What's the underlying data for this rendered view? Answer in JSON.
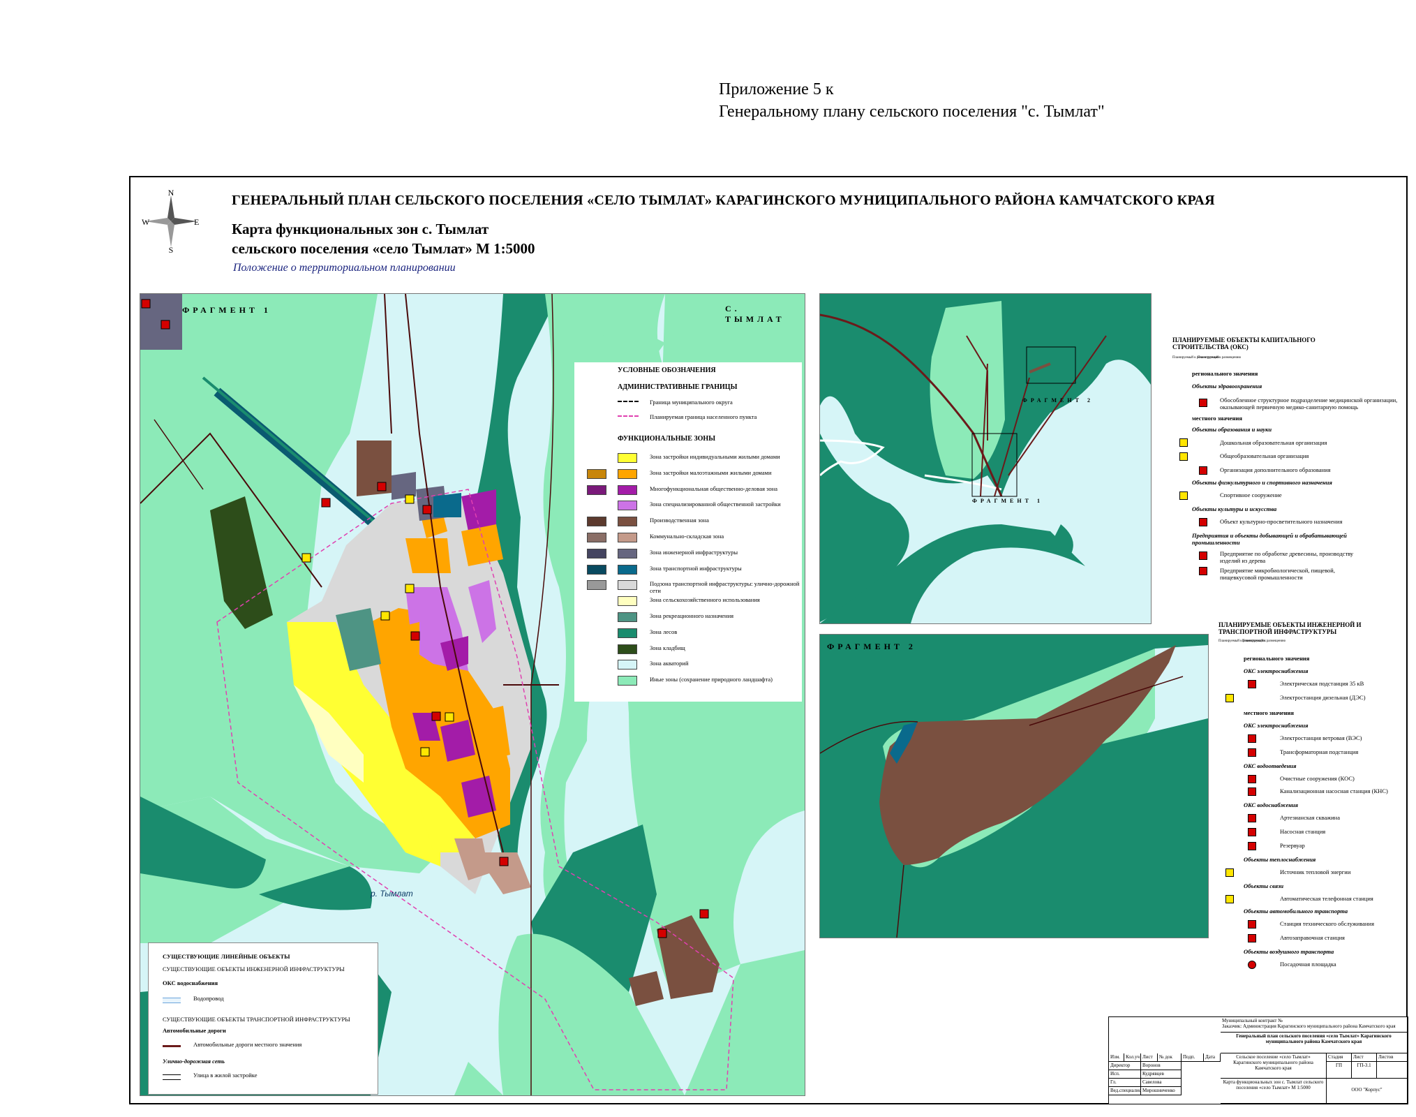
{
  "appendix": {
    "line1": "Приложение 5 к",
    "line2": "Генеральному плану сельского поселения \"с. Тымлат\""
  },
  "compass": {
    "n": "N",
    "s": "S",
    "w": "W",
    "e": "E"
  },
  "title": "ГЕНЕРАЛЬНЫЙ ПЛАН СЕЛЬСКОГО ПОСЕЛЕНИЯ «СЕЛО ТЫМЛАТ» КАРАГИНСКОГО МУНИЦИПАЛЬНОГО РАЙОНА КАМЧАТСКОГО КРАЯ",
  "subtitle": {
    "line1": "Карта функциональных зон с. Тымлат",
    "line2": "сельского поселения «село Тымлат»  М 1:5000"
  },
  "regulation": "Положение о территориальном планировании",
  "main_map": {
    "fragment_label": "ФРАГМЕНТ 1",
    "village_label": "С. ТЫМЛАТ",
    "river_label": "р. Тымлат"
  },
  "inset1": {
    "frag2_label": "ФРАГМЕНТ 2",
    "frag1_label": "ФРАГМЕНТ 1"
  },
  "inset2": {
    "label": "ФРАГМЕНТ 2"
  },
  "colors": {
    "water": "#d6f5f7",
    "natural": "#8ceab8",
    "forest": "#1a8c6e",
    "individual": "#ffff33",
    "lowrise": "#ffa500",
    "mixed": "#a31ca8",
    "special": "#cc73e6",
    "production": "#7a5040",
    "warehouse": "#c49a8a",
    "engineering": "#666680",
    "transport": "#0a6a8c",
    "street": "#d9d9d9",
    "agricultural": "#ffffc0",
    "recreation": "#4e9484",
    "cemetery": "#2d4d1a"
  },
  "legend": {
    "title": "УСЛОВНЫЕ ОБОЗНАЧЕНИЯ",
    "admin_header": "АДМИНИСТРАТИВНЫЕ ГРАНИЦЫ",
    "admin_items": [
      "Граница муниципального округа",
      "Планируемая граница населенного пункта"
    ],
    "zones_header": "ФУНКЦИОНАЛЬНЫЕ ЗОНЫ",
    "zones": [
      "Зона застройки индивидуальными жилыми домами",
      "Зона застройки малоэтажными жилыми домами",
      "Многофункциональная общественно-деловая зона",
      "Зона специализированной общественной застройки",
      "Производственная зона",
      "Коммунально-складская зона",
      "Зона инженерной инфраструктуры",
      "Зона транспортной инфраструктуры",
      "Подзона транспортной инфраструктуры: улично-дорожной сети",
      "Зона сельскохозяйственного использования",
      "Зона рекреационного назначения",
      "Зона лесов",
      "Зона кладбищ",
      "Зона акваторий",
      "Иные зоны (сохранение природного ландшафта)"
    ]
  },
  "linear_legend": {
    "title": "СУЩЕСТВУЮЩИЕ ЛИНЕЙНЫЕ ОБЪЕКТЫ",
    "eng_header": "СУЩЕСТВУЮЩИЕ ОБЪЕКТЫ ИНЖЕНЕРНОЙ ИНФРАСТРУКТУРЫ",
    "water_header": "ОКС водоснабжения",
    "water_item": "Водопровод",
    "transport_header": "СУЩЕСТВУЮЩИЕ ОБЪЕКТЫ ТРАНСПОРТНОЙ ИНФРАСТРУКТУРЫ",
    "roads_header": "Автомобильные дороги",
    "roads_item": "Автомобильные дороги местного значения",
    "street_header": "Улично-дорожная сеть",
    "street_item": "Улица в жилой застройке"
  },
  "planned_oks": {
    "title": "ПЛАНИРУЕМЫЕ ОБЪЕКТЫ КАПИТАЛЬНОГО СТРОИТЕЛЬСТВА (ОКС)",
    "col1": "Планируемый к реконструкции",
    "col2": "Планируемый к размещению",
    "regional": "регионального значения",
    "health": "Объекты здравоохранения",
    "health_item": "Обособленное структурное подразделение медицинской организации, оказывающей первичную медико-санитарную помощь",
    "local": "местного значения",
    "education": "Объекты образования и науки",
    "edu_items": [
      "Дошкольная образовательная организация",
      "Общеобразовательная организация",
      "Организация дополнительного образования"
    ],
    "sport": "Объекты физкультурного и спортивного назначения",
    "sport_item": "Спортивное сооружение",
    "culture": "Объекты культуры и искусства",
    "culture_item": "Объект культурно-просветительного назначения",
    "industry": "Предприятия и объекты добывающей и обрабатывающей промышленности",
    "industry_items": [
      "Предприятие по обработке древесины, производству изделий из дерева",
      "Предприятие микробиологической, пищевой, пищевкусовой промышленности"
    ]
  },
  "planned_eng": {
    "title": "ПЛАНИРУЕМЫЕ ОБЪЕКТЫ ИНЖЕНЕРНОЙ И ТРАНСПОРТНОЙ ИНФРАСТРУКТУРЫ",
    "col1": "Планируемый к реконструкции",
    "col2": "Планируемый к размещению",
    "regional": "регионального значения",
    "power_reg": "ОКС электроснабжения",
    "power_reg_items": [
      "Электрическая подстанция 35 кВ",
      "Электростанция дизельная (ДЭС)"
    ],
    "local": "местного значения",
    "power_loc": "ОКС электроснабжения",
    "power_loc_items": [
      "Электростанция ветровая (ВЭС)",
      "Трансформаторная подстанция"
    ],
    "sewer": "ОКС водоотведения",
    "sewer_items": [
      "Очистные сооружения (КОС)",
      "Канализационная насосная станция (КНС)"
    ],
    "water": "ОКС водоснабжения",
    "water_items": [
      "Артезианская скважина",
      "Насосная станция",
      "Резервуар"
    ],
    "heat": "Объекты теплоснабжения",
    "heat_item": "Источник тепловой энергии",
    "comm": "Объекты связи",
    "comm_item": "Автоматическая телефонная станция",
    "auto": "Объекты автомобильного транспорта",
    "auto_items": [
      "Станция технического обслуживания",
      "Автозаправочная станция"
    ],
    "air": "Объекты воздушного транспорта",
    "air_item": "Посадочная площадка"
  },
  "stamp": {
    "contract": "Муниципальный контракт №",
    "customer": "Заказчик: Администрация Карагинского муниципального района Камчатского края",
    "project": "Генеральный план сельского поселения «село Тымлат» Карагинского муниципального района Камчатского края",
    "headers": [
      "Изм.",
      "Кол.уч",
      "Лист",
      "№ док",
      "Подп.",
      "Дата"
    ],
    "roles": [
      "Директор",
      "Исп. директор",
      "Гл. архитектор",
      "Вед.специалист"
    ],
    "names": [
      "Воронов",
      "Кудрявцев",
      "Савелова",
      "Мирошниченко"
    ],
    "object": "Сельское поселение «село Тымлат» Карагинского муниципального района Камчатского края",
    "stage_h": "Стадия",
    "sheet_h": "Лист",
    "sheets_h": "Листов",
    "stage": "ГП",
    "sheet": "ГП-3.1",
    "sheet_title": "Карта функциональных зон с. Тымлат сельского поселения «село Тымлат» М 1:5000",
    "company": "ООО \"Корпус\""
  }
}
